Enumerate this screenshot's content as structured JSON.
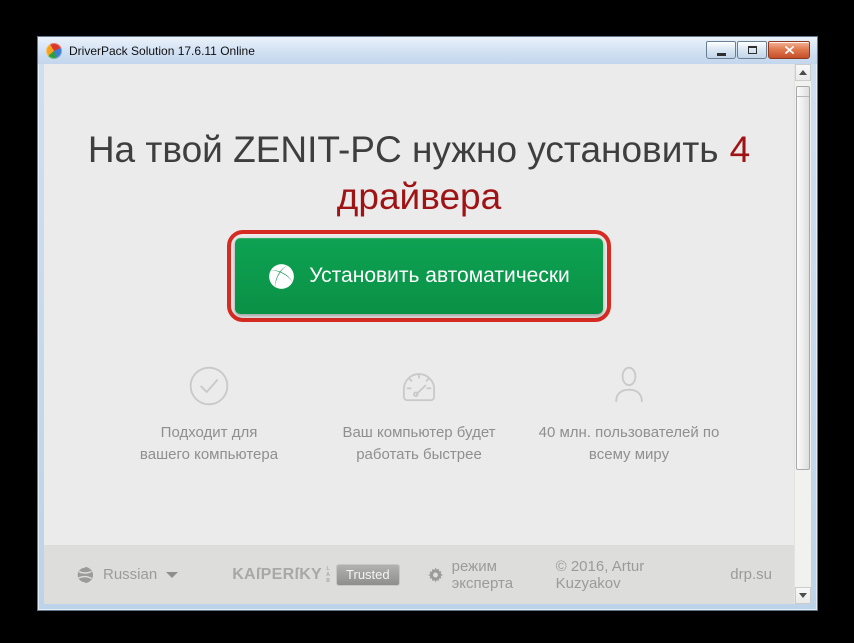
{
  "window": {
    "title": "DriverPack Solution 17.6.11 Online"
  },
  "heading": {
    "line1_dark": "На твой ZENIT-PC нужно установить",
    "line1_red": "4",
    "line2_red": "драйвера"
  },
  "install_button": {
    "label": "Установить автоматически"
  },
  "features": [
    {
      "icon": "check-circle-icon",
      "lines": [
        "Подходит для",
        "вашего компьютера"
      ]
    },
    {
      "icon": "speedometer-icon",
      "lines": [
        "Ваш компьютер будет",
        "работать быстрее"
      ]
    },
    {
      "icon": "user-icon",
      "lines": [
        "40 млн. пользователей по",
        "всему миру"
      ]
    }
  ],
  "footer": {
    "language": "Russian",
    "kaspersky_brand": "KAſPERſKY",
    "kaspersky_lab": "LAB",
    "trusted_badge": "Trusted",
    "expert_mode": "режим эксперта",
    "copyright": "© 2016, Artur Kuzyakov",
    "site": "drp.su"
  },
  "colors": {
    "button_green": "#0a9a4b",
    "annotation_red": "#d52b22",
    "heading_red": "#9f1314",
    "heading_dark": "#3e3e3e",
    "content_bg": "#ebebeb",
    "footer_bg": "#dddddb"
  }
}
